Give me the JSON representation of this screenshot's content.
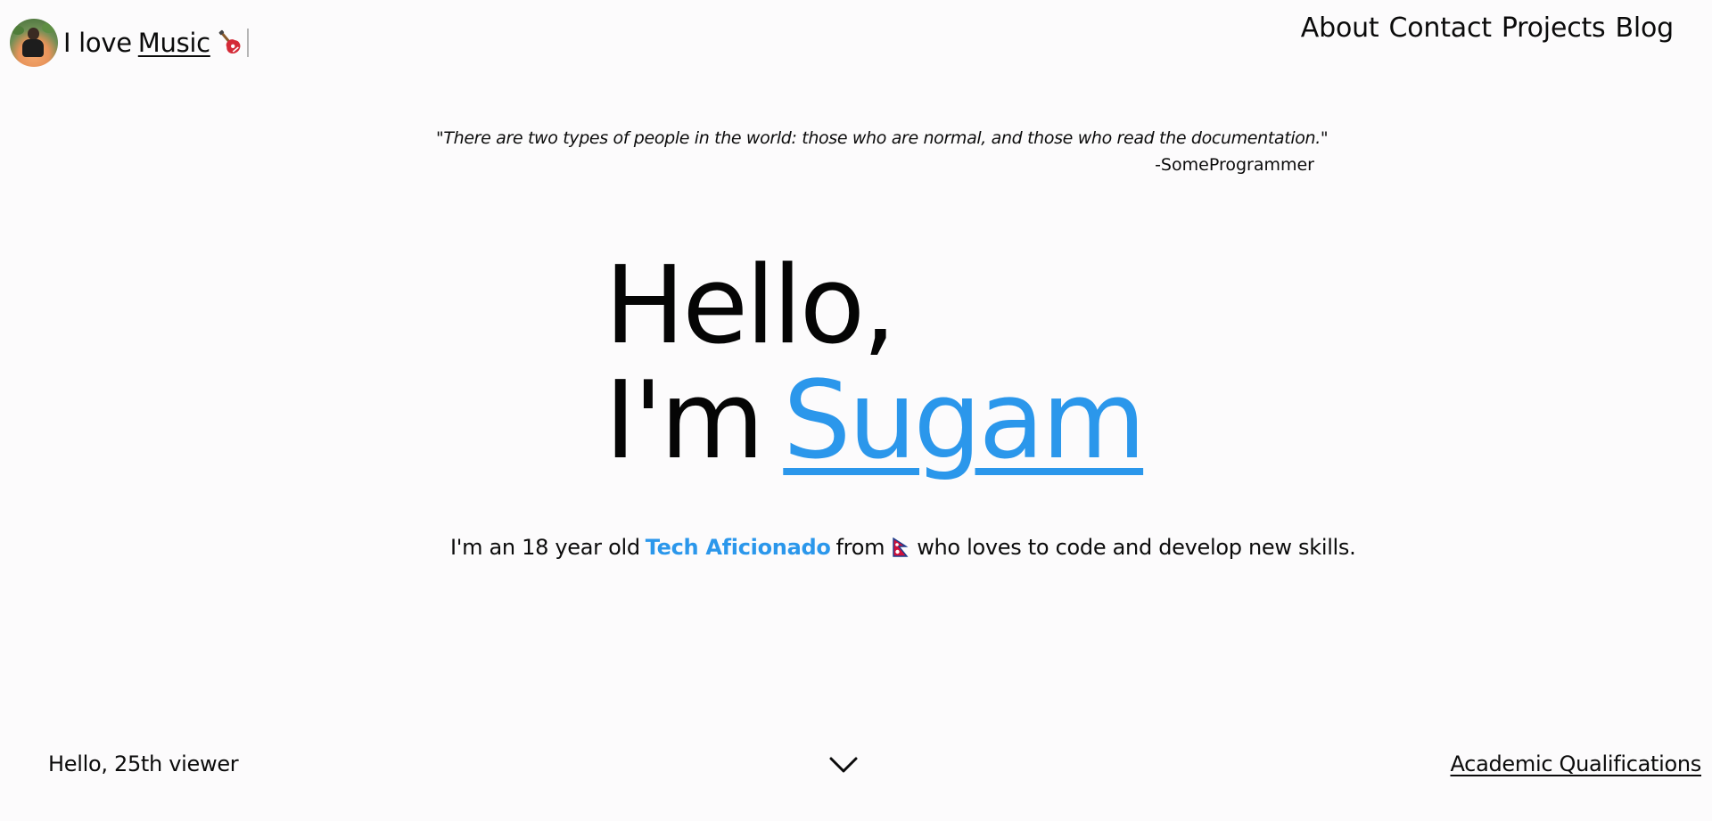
{
  "header": {
    "brand_prefix": "I love",
    "brand_word": "Music",
    "brand_emoji_icon": "guitar-icon",
    "nav": [
      {
        "label": "About"
      },
      {
        "label": "Contact"
      },
      {
        "label": "Projects"
      },
      {
        "label": "Blog"
      }
    ]
  },
  "quote": {
    "text": "\"There are two types of people in the world: those who are normal, and those who read the documentation.\"",
    "author": "-SomeProgrammer"
  },
  "hero": {
    "greeting": "Hello,",
    "prefix": "I'm",
    "name": "Sugam"
  },
  "intro": {
    "before": "I'm an 18 year old",
    "highlight": "Tech Aficionado",
    "middle": "from",
    "flag_icon": "nepal-flag-icon",
    "after": "who loves to code and develop new skills."
  },
  "footer": {
    "viewer_text": "Hello, 25th viewer",
    "scroll_icon": "chevron-down-icon",
    "link_label": "Academic Qualifications"
  },
  "colors": {
    "background": "#fcfbfc",
    "accent": "#2b97eb",
    "text": "#0b0b0b"
  }
}
